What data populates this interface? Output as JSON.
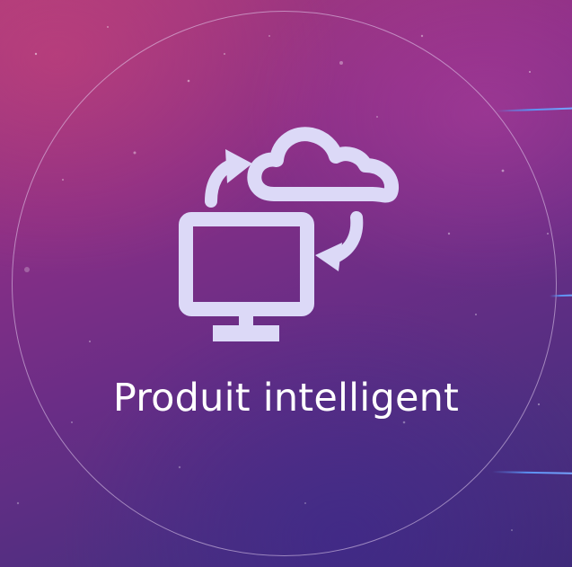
{
  "slide": {
    "title": "Produit intelligent",
    "icon": "cloud-sync-monitor-icon"
  },
  "colors": {
    "icon": "#dcd9f7",
    "text": "#ffffff",
    "accent_line": "#5a8ff0"
  }
}
